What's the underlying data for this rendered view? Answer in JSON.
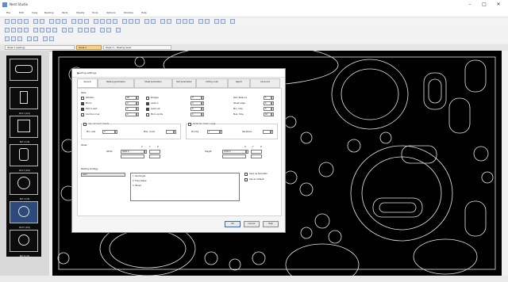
{
  "window": {
    "title": "Nest Studio",
    "min": "–",
    "max": "□",
    "close": "✕"
  },
  "menu": [
    "File",
    "Edit",
    "View",
    "Nesting",
    "Parts",
    "Sheets",
    "Tools",
    "Options",
    "Window",
    "Help"
  ],
  "doc_tabs": [
    "Sheet 1 (nesting)",
    "Sheet 2",
    "Sheet 3 — Nesting result"
  ],
  "thumbs": [
    {
      "label": ""
    },
    {
      "label": "Part 1 (x12)"
    },
    {
      "label": "Part 2 (x8)"
    },
    {
      "label": "Part 3 (x24)"
    },
    {
      "label": "Part 4 (x6)"
    },
    {
      "label": "Part 5 (x10)"
    },
    {
      "label": "Part 6 (x4)"
    }
  ],
  "dialog": {
    "title": "Nesting settings",
    "close": "✕",
    "tabs": [
      "General",
      "Nesting parameters",
      "Sheet parameters",
      "Part parameters",
      "Cutting order",
      "Report",
      "Advanced"
    ],
    "sec_parts": "Parts",
    "left_checks": [
      {
        "label": "Rotation",
        "on": false,
        "value": "90"
      },
      {
        "label": "Mirror",
        "on": true,
        "value": "0"
      },
      {
        "label": "Part in part",
        "on": true,
        "value": "0"
      },
      {
        "label": "Common line",
        "on": false,
        "value": "0"
      }
    ],
    "mid_checks": [
      {
        "label": "Bridges",
        "on": false,
        "value": "0"
      },
      {
        "label": "Lead-in",
        "on": true,
        "value": "0"
      },
      {
        "label": "Lead-out",
        "on": true,
        "value": "0"
      },
      {
        "label": "Micro-joints",
        "on": false,
        "value": "0"
      }
    ],
    "right_rows": [
      {
        "label": "Part distance",
        "value": "5"
      },
      {
        "label": "Sheet edge",
        "value": "5"
      },
      {
        "label": "Min. hole",
        "value": "0"
      },
      {
        "label": "Max. time",
        "value": "60"
      }
    ],
    "grp_left_title": "Use remnant sheets",
    "grp_left_field_label": "Min. size",
    "grp_left_value": "0",
    "grp_left_right_label": "Max. count",
    "grp_right_title": "Optimize sheet usage",
    "grp_right_field_label": "Priority",
    "grp_right_value": "1",
    "grp_right_right_label": "Iterations",
    "sec_sheet": "Sheet",
    "sheet_left_hdr": [
      "X",
      "Y",
      "Z"
    ],
    "sheet_left_label": "Width",
    "sheet_left_value": "3000.0",
    "sheet_right_hdr": [
      "X",
      "Y",
      "Z"
    ],
    "sheet_right_label": "Height",
    "sheet_right_value": "1500.0",
    "sec_strategy": "Nesting strategy",
    "strategy_value": "Auto",
    "list_items": [
      "1. Rectangle",
      "2. Free shape",
      "3. Mixed"
    ],
    "right_opts": [
      {
        "label": "Save as template",
        "on": false
      },
      {
        "label": "Use as default",
        "on": false
      }
    ],
    "buttons": {
      "ok": "OK",
      "cancel": "Cancel",
      "help": "Help"
    }
  }
}
